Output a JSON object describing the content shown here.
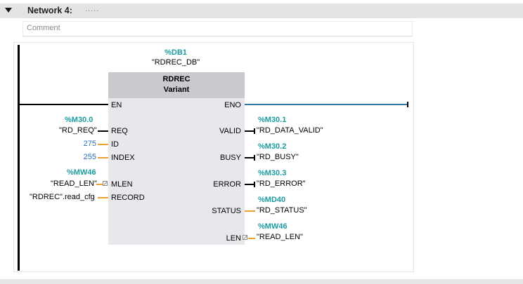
{
  "network": {
    "title": "Network 4:",
    "title_dots": ".....",
    "comment_placeholder": "Comment"
  },
  "block": {
    "instance_address": "%DB1",
    "instance_name": "\"RDREC_DB\"",
    "type": "RDREC",
    "subtype": "Variant"
  },
  "inputs": {
    "en": {
      "pin": "EN"
    },
    "req": {
      "pin": "REQ",
      "address": "%M30.0",
      "operand": "\"RD_REQ\""
    },
    "id": {
      "pin": "ID",
      "value": "275"
    },
    "index": {
      "pin": "INDEX",
      "value": "255"
    },
    "mlen": {
      "pin": "MLEN",
      "address": "%MW46",
      "operand": "\"READ_LEN\""
    },
    "record": {
      "pin": "RECORD",
      "operand": "\"RDREC\".read_cfg"
    }
  },
  "outputs": {
    "eno": {
      "pin": "ENO"
    },
    "valid": {
      "pin": "VALID",
      "address": "%M30.1",
      "operand": "\"RD_DATA_VALID\""
    },
    "busy": {
      "pin": "BUSY",
      "address": "%M30.2",
      "operand": "\"RD_BUSY\""
    },
    "error": {
      "pin": "ERROR",
      "address": "%M30.3",
      "operand": "\"RD_ERROR\""
    },
    "status": {
      "pin": "STATUS",
      "address": "%MD40",
      "operand": "\"RD_STATUS\""
    },
    "len": {
      "pin": "LEN",
      "address": "%MW46",
      "operand": "\"READ_LEN\""
    }
  },
  "colors": {
    "address": "#1b9ba0",
    "constant": "#2a6dbd",
    "wire_bool": "#000000",
    "wire_data": "#f0a030",
    "eno_wire": "#2f78a8",
    "block_body": "#e8e8ec",
    "block_header": "#c9cace"
  }
}
